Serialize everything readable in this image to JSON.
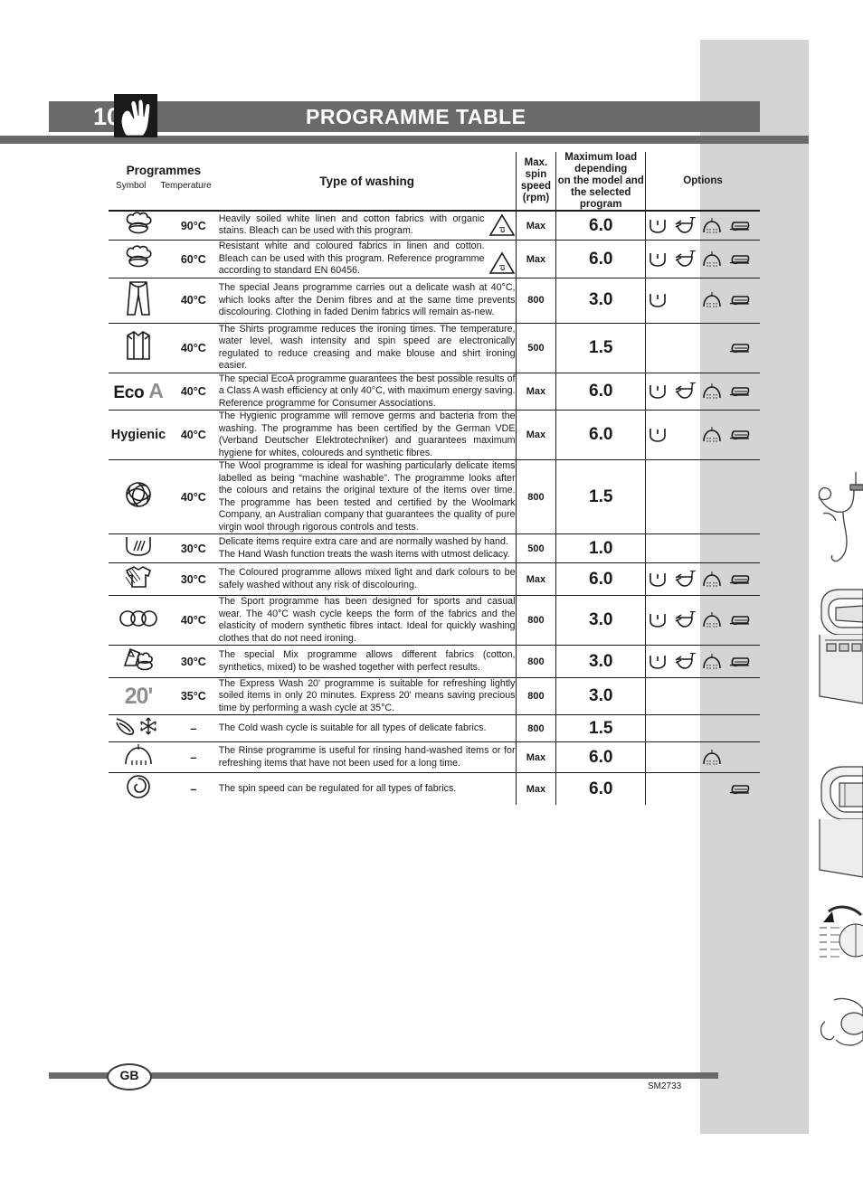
{
  "page": {
    "number": "10",
    "title": "PROGRAMME TABLE",
    "hand_icon": "hand-icon"
  },
  "table": {
    "headers": {
      "programmes": "Programmes",
      "symbol": "Symbol",
      "temperature": "Temperature",
      "type_of_washing": "Type of washing",
      "max_spin_speed": "Max. spin speed (rpm)",
      "max_spin_speed_lines": [
        "Max. spin",
        "speed",
        "(rpm)"
      ],
      "maximum_load": "Maximum load depending on the model and the selected program",
      "maximum_load_lines": [
        "Maximum load",
        "depending",
        "on the model and",
        "the selected",
        "program"
      ],
      "options": "Options"
    },
    "rows": [
      {
        "symbol_name": "cotton-icon",
        "symbol_kind": "cotton",
        "temperature": "90°C",
        "description": "Heavily soiled white linen and cotton fabrics with organic stains. Bleach can be used with this program.",
        "bleach": true,
        "spin": "Max",
        "load": "6.0",
        "options": [
          "prewash",
          "delay",
          "rinse",
          "iron"
        ]
      },
      {
        "symbol_name": "cotton-icon",
        "symbol_kind": "cotton",
        "temperature": "60°C",
        "description": "Resistant white and coloured fabrics in linen and cotton. Bleach can be used with this program. Reference programme according to standard EN 60456.",
        "bleach": true,
        "spin": "Max",
        "load": "6.0",
        "options": [
          "prewash",
          "delay",
          "rinse",
          "iron"
        ]
      },
      {
        "symbol_name": "jeans-icon",
        "symbol_kind": "jeans",
        "temperature": "40°C",
        "description": "The special Jeans programme carries out a delicate wash at 40°C, which looks after the Denim fibres and at the same time prevents discolouring. Clothing in faded Denim fabrics will remain as-new.",
        "bleach": false,
        "spin": "800",
        "load": "3.0",
        "options": [
          "prewash",
          "",
          "rinse",
          "iron"
        ]
      },
      {
        "symbol_name": "shirt-icon",
        "symbol_kind": "shirt",
        "temperature": "40°C",
        "description": "The Shirts programme reduces the ironing times. The temperature, water level, wash intensity and spin speed are electronically regulated to reduce creasing and make blouse and shirt ironing easier.",
        "bleach": false,
        "spin": "500",
        "load": "1.5",
        "options": [
          "",
          "",
          "",
          "iron"
        ]
      },
      {
        "symbol_name": "eco-a-label",
        "symbol_kind": "eco",
        "symbol_text": "Eco",
        "symbol_text2": "A",
        "temperature": "40°C",
        "description": "The special EcoA programme guarantees the best possible results of a Class A wash efficiency at only 40°C, with maximum energy saving. Reference programme for Consumer Associations.",
        "bleach": false,
        "spin": "Max",
        "load": "6.0",
        "options": [
          "prewash",
          "delay",
          "rinse",
          "iron"
        ]
      },
      {
        "symbol_name": "hygienic-label",
        "symbol_kind": "hygienic",
        "symbol_text": "Hygienic",
        "temperature": "40°C",
        "description": "The Hygienic programme will remove germs and bacteria from the washing. The programme has been certified by the German VDE (Verband Deutscher Elektrotechniker) and guarantees maximum hygiene for whites, coloureds and synthetic fibres.",
        "bleach": false,
        "spin": "Max",
        "load": "6.0",
        "options": [
          "prewash",
          "",
          "rinse",
          "iron"
        ]
      },
      {
        "symbol_name": "wool-icon",
        "symbol_kind": "wool",
        "temperature": "40°C",
        "description": "The Wool programme is ideal for washing particularly delicate items labelled as being “machine washable”. The programme looks after the colours and retains the original texture of the items over time. The programme has been tested and certified by the Woolmark Company, an Australian company that guarantees the quality of pure virgin wool through rigorous controls and tests.",
        "bleach": false,
        "spin": "800",
        "load": "1.5",
        "options": []
      },
      {
        "symbol_name": "hand-wash-icon",
        "symbol_kind": "handwash",
        "temperature": "30°C",
        "description": "Delicate items require extra care and are normally washed by hand.\nThe Hand Wash function treats the wash items with utmost delicacy.",
        "bleach": false,
        "spin": "500",
        "load": "1.0",
        "options": []
      },
      {
        "symbol_name": "coloured-icon",
        "symbol_kind": "coloured",
        "temperature": "30°C",
        "description": "The Coloured programme allows mixed light and dark colours to be safely washed without any risk of discolouring.",
        "bleach": false,
        "spin": "Max",
        "load": "6.0",
        "options": [
          "prewash",
          "delay",
          "rinse",
          "iron"
        ]
      },
      {
        "symbol_name": "sport-icon",
        "symbol_kind": "sport",
        "temperature": "40°C",
        "description": "The Sport programme has been designed for sports and casual wear. The 40°C wash cycle keeps the form of the fabrics and the elasticity of modern synthetic fibres intact. Ideal for quickly washing clothes that do not need ironing.",
        "bleach": false,
        "spin": "800",
        "load": "3.0",
        "options": [
          "prewash",
          "delay",
          "rinse",
          "iron"
        ]
      },
      {
        "symbol_name": "mix-icon",
        "symbol_kind": "mix",
        "temperature": "30°C",
        "description": "The special Mix programme allows different fabrics (cotton, synthetics, mixed) to be washed together with perfect results.",
        "bleach": false,
        "spin": "800",
        "load": "3.0",
        "options": [
          "prewash",
          "delay",
          "rinse",
          "iron"
        ]
      },
      {
        "symbol_name": "express-20-label",
        "symbol_kind": "express20",
        "symbol_text": "20'",
        "temperature": "35°C",
        "description": "The Express Wash 20' programme is suitable for refreshing lightly soiled items in only 20 minutes. Express 20' means saving precious time by performing a wash cycle at 35°C.",
        "bleach": false,
        "spin": "800",
        "load": "3.0",
        "options": []
      },
      {
        "symbol_name": "cold-wash-icon",
        "symbol_kind": "cold",
        "temperature": "–",
        "description": "The Cold wash cycle is suitable for all types of delicate fabrics.",
        "bleach": false,
        "spin": "800",
        "load": "1.5",
        "options": []
      },
      {
        "symbol_name": "rinse-icon",
        "symbol_kind": "rinse",
        "temperature": "–",
        "description": "The Rinse programme is useful for rinsing hand-washed items or for refreshing items that have not been used for a long time.",
        "bleach": false,
        "spin": "Max",
        "load": "6.0",
        "options": [
          "",
          "",
          "rinse",
          ""
        ]
      },
      {
        "symbol_name": "spin-icon",
        "symbol_kind": "spin",
        "temperature": "–",
        "description": "The spin speed can be regulated for all types of fabrics.",
        "bleach": false,
        "spin": "Max",
        "load": "6.0",
        "options": [
          "",
          "",
          "",
          "iron"
        ]
      }
    ]
  },
  "footer": {
    "country_code": "GB",
    "doc_code": "SM2733"
  },
  "colors": {
    "header_bar": "#6a6a6a",
    "grey_band": "#d4d4d4",
    "grey_symbol": "#8f8f8f",
    "text": "#1a1a1a"
  }
}
